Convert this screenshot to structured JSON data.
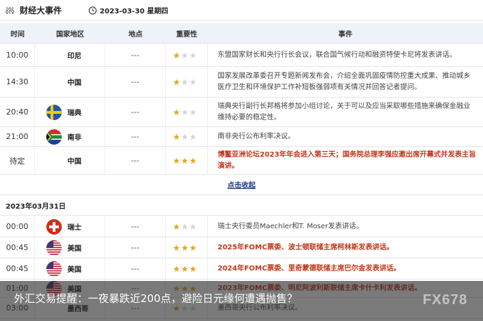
{
  "header": {
    "title": "财经大事件",
    "date": "2023-03-30 星期四"
  },
  "columns": {
    "time": "时间",
    "country": "国家地区",
    "place": "地点",
    "importance": "重要性",
    "event": "事件"
  },
  "rows_day1": [
    {
      "time": "10:00",
      "country": "印尼",
      "flag": "none",
      "place": "---",
      "stars": 1,
      "event": "东盟国家财长和央行行长会议，联合国气候行动和融资特使卡尼将发表讲话。",
      "highlight": false
    },
    {
      "time": "14:30",
      "country": "中国",
      "flag": "none",
      "place": "---",
      "stars": 1,
      "event": "国家发展改革委召开专题新闻发布会，介绍全面巩固疫情防控重大成果、推动城乡医疗卫生和环境保护工作补短板强弱项有关情况并回答记者提问。",
      "highlight": false
    },
    {
      "time": "20:40",
      "country": "瑞典",
      "flag": "sweden",
      "place": "---",
      "stars": 1,
      "event": "瑞典央行副行长邦格将参加小组讨论，关于可以及应当采取哪些措施来确保金融业维持必要的稳定性。",
      "highlight": false
    },
    {
      "time": "21:00",
      "country": "南非",
      "flag": "southafrica",
      "place": "---",
      "stars": 1,
      "event": "南非央行公布利率决议。",
      "highlight": false
    },
    {
      "time": "待定",
      "country": "中国",
      "flag": "none",
      "place": "---",
      "stars": 3,
      "event": "博鳌亚洲论坛2023年年会进入第三天；国务院总理李强应邀出席开幕式并发表主旨演讲。",
      "highlight": true
    }
  ],
  "collapse_label": "点击收起",
  "day2_label": "2023年03月31日",
  "rows_day2": [
    {
      "time": "00:00",
      "country": "瑞士",
      "flag": "swiss",
      "place": "---",
      "stars": 1,
      "event": "瑞士央行委员Maechler和T. Moser发表讲话。",
      "highlight": false
    },
    {
      "time": "00:45",
      "country": "美国",
      "flag": "usa",
      "place": "---",
      "stars": 3,
      "event": "2025年FOMC票委、波士顿联储主席柯林斯发表讲话。",
      "highlight": true
    },
    {
      "time": "00:45",
      "country": "美国",
      "flag": "usa",
      "place": "---",
      "stars": 3,
      "event": "2024年FOMC票委、里奇蒙德联储主席巴尔金发表讲话。",
      "highlight": true
    },
    {
      "time": "01:00",
      "country": "美国",
      "flag": "usa",
      "place": "---",
      "stars": 3,
      "event": "2023年FOMC票委、明尼阿波利斯联储主席卡什卡利发表讲话。",
      "highlight": true
    },
    {
      "time": "03:00",
      "country": "墨西哥",
      "flag": "none",
      "place": "---",
      "stars": 1,
      "event": "墨西哥央行公布利率决议。",
      "highlight": false
    }
  ],
  "overlay": {
    "headline": "外汇交易提醒：一夜暴跌近200点，避险日元缘何遭遇抛售？",
    "watermark": "FX678"
  },
  "colors": {
    "star": "#e8a317",
    "highlight": "#c0391b",
    "header_bg": "#eef2f9"
  }
}
